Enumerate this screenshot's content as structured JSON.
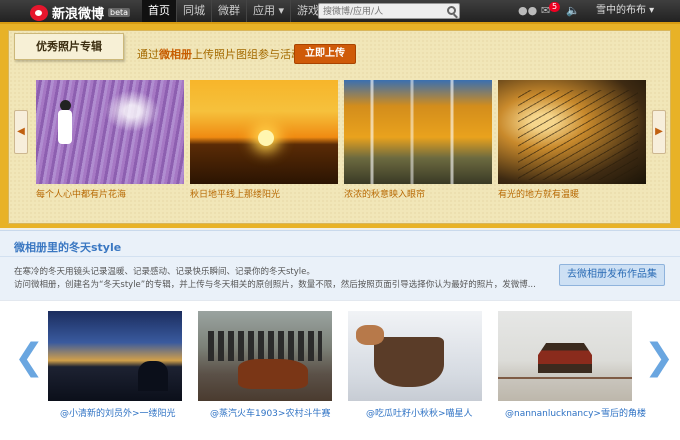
{
  "topbar": {
    "logo": "新浪微博",
    "beta": "beta",
    "nav": [
      {
        "label": "首页",
        "active": true
      },
      {
        "label": "同城",
        "active": false
      },
      {
        "label": "微群",
        "active": false
      },
      {
        "label": "应用 ▾",
        "active": false
      },
      {
        "label": "游戏 ▾",
        "active": false
      }
    ],
    "search_placeholder": "搜微博/应用/人",
    "mail_badge": "5",
    "user": "雪中的布布 ▾"
  },
  "featured": {
    "ribbon": "优秀照片专辑",
    "tagline_prefix": "通过",
    "tagline_highlight": "微相册",
    "tagline_suffix": "上传照片图组参与活动",
    "join_button": "立即上传",
    "photos": [
      {
        "caption": "每个人心中都有片花海"
      },
      {
        "caption": "秋日地平线上那缕阳光"
      },
      {
        "caption": "浓浓的秋意映入眼帘"
      },
      {
        "caption": "有光的地方就有温暖"
      }
    ]
  },
  "winter": {
    "title": "微相册里的冬天style",
    "desc_line1": "在寒冷的冬天用镜头记录温暖、记录感动、记录快乐瞬间、记录你的冬天style。",
    "desc_line2": "访问微相册，创建名为“冬天style”的专辑，并上传与冬天相关的原创照片，数量不限，然后按照页面引导选择你认为最好的照片，发微博...",
    "publish_button": "去微相册发布作品集",
    "photos": [
      {
        "caption": "@小清新的刘员外>一缕阳光"
      },
      {
        "caption": "@蒸汽火车1903>农村斗牛赛"
      },
      {
        "caption": "@吃瓜吐籽小秋秋>喵星人"
      },
      {
        "caption": "@nannanlucknancy>雪后的角楼"
      }
    ]
  },
  "colors": {
    "featured_bg": "#e8b227",
    "accent_orange": "#cf5a08",
    "link_blue": "#2e72c4",
    "badge_red": "#e02"
  }
}
